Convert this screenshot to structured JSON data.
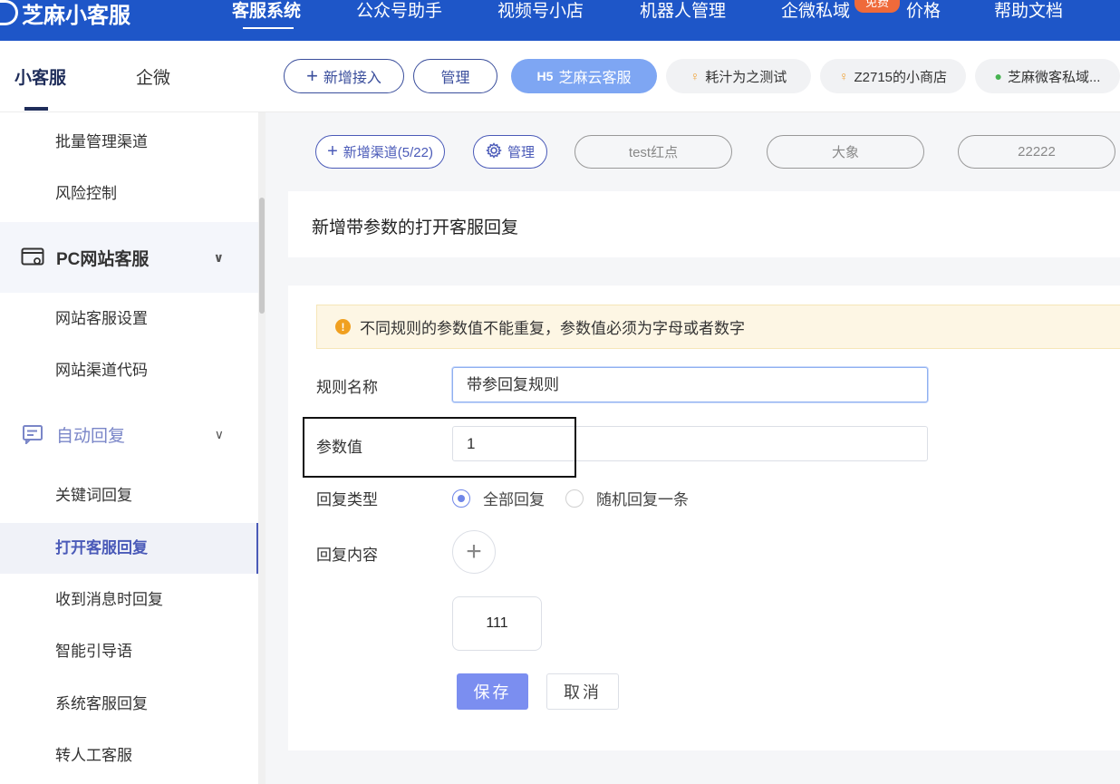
{
  "topnav": {
    "logo": "芝麻小客服",
    "items": [
      "客服系统",
      "公众号助手",
      "视频号小店",
      "机器人管理",
      "企微私域",
      "价格",
      "帮助文档"
    ],
    "badge": "免费"
  },
  "secbar": {
    "tabs": [
      "小客服",
      "企微"
    ],
    "add_access": "新增接入",
    "manage": "管理",
    "active_channel": "芝麻云客服",
    "active_channel_prefix": "H5",
    "apps": [
      "耗汁为之测试",
      "Z2715的小商店",
      "芝麻微客私域..."
    ]
  },
  "sidebar": {
    "items": [
      "批量管理渠道",
      "风险控制"
    ],
    "group_pc": "PC网站客服",
    "pc_items": [
      "网站客服设置",
      "网站渠道代码"
    ],
    "group_auto": "自动回复",
    "auto_items": [
      "关键词回复",
      "打开客服回复",
      "收到消息时回复",
      "智能引导语",
      "系统客服回复",
      "转人工客服"
    ]
  },
  "channels": {
    "add": "新增渠道(5/22)",
    "manage": "管理",
    "items": [
      "test红点",
      "大象",
      "22222"
    ]
  },
  "page": {
    "title": "新增带参数的打开客服回复"
  },
  "form": {
    "alert": "不同规则的参数值不能重复，参数值必须为字母或者数字",
    "rule_name_label": "规则名称",
    "rule_name_value": "带参回复规则",
    "param_label": "参数值",
    "param_value": "1",
    "reply_type_label": "回复类型",
    "reply_type_options": [
      "全部回复",
      "随机回复一条"
    ],
    "reply_type_selected": "全部回复",
    "reply_content_label": "回复内容",
    "reply_content_item": "111",
    "save": "保存",
    "cancel": "取消"
  },
  "colors": {
    "nav_bg": "#1e56c8",
    "active_pill": "#7ea6f3",
    "primary_button": "#7b8ef0",
    "alert_bg": "#fdf6e4"
  }
}
